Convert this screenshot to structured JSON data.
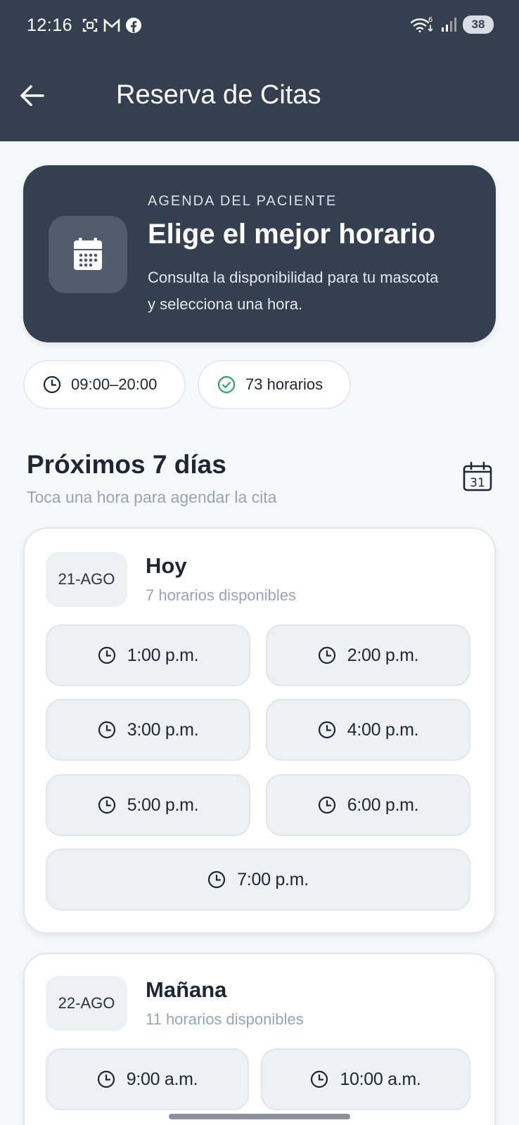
{
  "status": {
    "time": "12:16",
    "battery": "38",
    "network_sup": "6"
  },
  "header": {
    "title": "Reserva de Citas"
  },
  "hero": {
    "kicker": "AGENDA DEL PACIENTE",
    "title": "Elige el mejor horario",
    "description": "Consulta la disponibilidad para tu mascota y selecciona una hora."
  },
  "chips": {
    "hours": "09:00–20:00",
    "slots": "73 horarios"
  },
  "section": {
    "title": "Próximos 7 días",
    "subtitle": "Toca una hora para agendar la cita"
  },
  "days": [
    {
      "date": "21-AGO",
      "name": "Hoy",
      "available": "7 horarios disponibles",
      "slots": [
        "1:00 p.m.",
        "2:00 p.m.",
        "3:00 p.m.",
        "4:00 p.m.",
        "5:00 p.m.",
        "6:00 p.m.",
        "7:00 p.m."
      ]
    },
    {
      "date": "22-AGO",
      "name": "Mañana",
      "available": "11 horarios disponibles",
      "slots": [
        "9:00 a.m.",
        "10:00 a.m."
      ]
    }
  ],
  "colors": {
    "header_bg": "#343f50",
    "slot_bg": "#eef0f4",
    "check_green": "#2eaa5c",
    "muted_text": "#9aa3b1"
  }
}
